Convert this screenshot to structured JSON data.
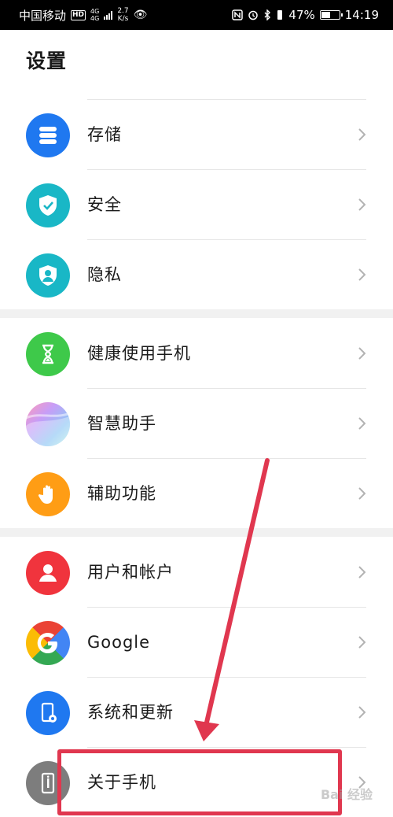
{
  "status_bar": {
    "carrier": "中国移动",
    "hd": "HD",
    "network_type_top": "4G",
    "network_type_bottom": "4G",
    "speed_value": "2.7",
    "speed_unit": "K/s",
    "battery_percent": "47%",
    "battery_level": 0.47,
    "time": "14:19",
    "icons": [
      "nfc-icon",
      "alarm-icon",
      "bluetooth-icon",
      "vibrate-icon"
    ]
  },
  "header": {
    "title": "设置"
  },
  "settings": {
    "items": [
      {
        "label": "存储",
        "icon": "storage-icon",
        "color": "#1f78f0"
      },
      {
        "label": "安全",
        "icon": "shield-check-icon",
        "color": "#19b7c6"
      },
      {
        "label": "隐私",
        "icon": "privacy-icon",
        "color": "#19b7c6"
      },
      {
        "label": "健康使用手机",
        "icon": "hourglass-icon",
        "color": "#3ec94a"
      },
      {
        "label": "智慧助手",
        "icon": "assistant-icon",
        "color": "#b48cf5"
      },
      {
        "label": "辅助功能",
        "icon": "hand-icon",
        "color": "#ff9d15"
      },
      {
        "label": "用户和帐户",
        "icon": "user-icon",
        "color": "#f0343d"
      },
      {
        "label": "Google",
        "icon": "google-icon",
        "color": "#4285f4"
      },
      {
        "label": "系统和更新",
        "icon": "phone-gear-icon",
        "color": "#1f78f0"
      },
      {
        "label": "关于手机",
        "icon": "phone-info-icon",
        "color": "#7d7d7d"
      }
    ]
  },
  "annotation": {
    "color": "#e0374f"
  },
  "watermark": {
    "text": "Bai 经验"
  }
}
